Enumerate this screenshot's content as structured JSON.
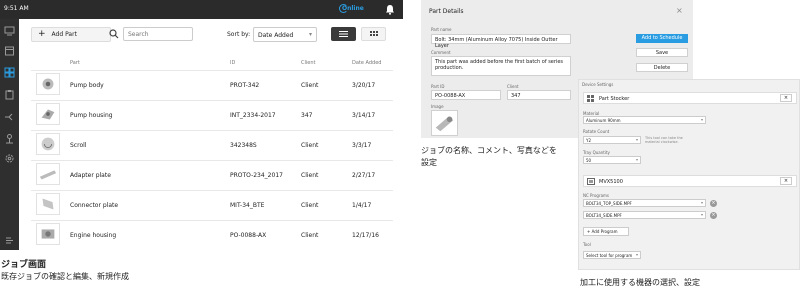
{
  "jobs_screen": {
    "status": {
      "time": "9:51 AM",
      "online": "Online"
    },
    "toolbar": {
      "add_part": "Add Part",
      "search_placeholder": "Search",
      "sort_label": "Sort by:",
      "sort_value": "Date Added"
    },
    "columns": [
      "Part",
      "ID",
      "Client",
      "Date Added"
    ],
    "rows": [
      {
        "name": "Pump body",
        "id": "PROT-342",
        "client": "Client",
        "date": "3/20/17"
      },
      {
        "name": "Pump housing",
        "id": "INT_2334-2017",
        "client": "347",
        "date": "3/14/17"
      },
      {
        "name": "Scroll",
        "id": "342348S",
        "client": "Client",
        "date": "3/3/17"
      },
      {
        "name": "Adapter plate",
        "id": "PROTO-234_2017",
        "client": "Client",
        "date": "2/27/17"
      },
      {
        "name": "Connector plate",
        "id": "MIT-34_BTE",
        "client": "Client",
        "date": "1/4/17"
      },
      {
        "name": "Engine housing",
        "id": "PO-0088-AX",
        "client": "Client",
        "date": "12/17/16"
      }
    ]
  },
  "part_details": {
    "title": "Part Details",
    "part_name_label": "Part name",
    "part_name": "Bolt: 34mm (Aluminum Alloy 7075) Inside Outter Layer",
    "comment_label": "Comment",
    "comment": "This part was added before the first batch of series production.",
    "part_id_label": "Part ID",
    "part_id": "PO-0088-AX",
    "client_label": "Client",
    "client": "347",
    "image_label": "Image",
    "buttons": {
      "schedule": "Add to Schedule",
      "save": "Save",
      "delete": "Delete"
    }
  },
  "device_settings": {
    "header": "Device Settings",
    "device1": {
      "name": "Part Stocker",
      "material_label": "Material",
      "material": "Aluminum 90mm",
      "rotate_label": "Rotate Count",
      "rotate": "Y2",
      "rotate_note": "This tool can take the material clockwise.",
      "qty_label": "Tray Quantity",
      "qty": "50"
    },
    "device2": {
      "name": "MVX5100",
      "nc_label": "NC Programs",
      "programs": [
        "BOLT34_TOP_SIDE.MPF",
        "BOLT34_SIDE.MPF"
      ],
      "add_program": "Add Program",
      "tool_label": "Tool",
      "tool_placeholder": "Select tool for program"
    }
  },
  "captions": {
    "jobs_title": "ジョブ画面",
    "jobs_sub": "既存ジョブの確認と編集、新規作成",
    "details": "ジョブの名称、コメント、写真などを設定",
    "devices": "加工に使用する機器の選択、設定"
  }
}
